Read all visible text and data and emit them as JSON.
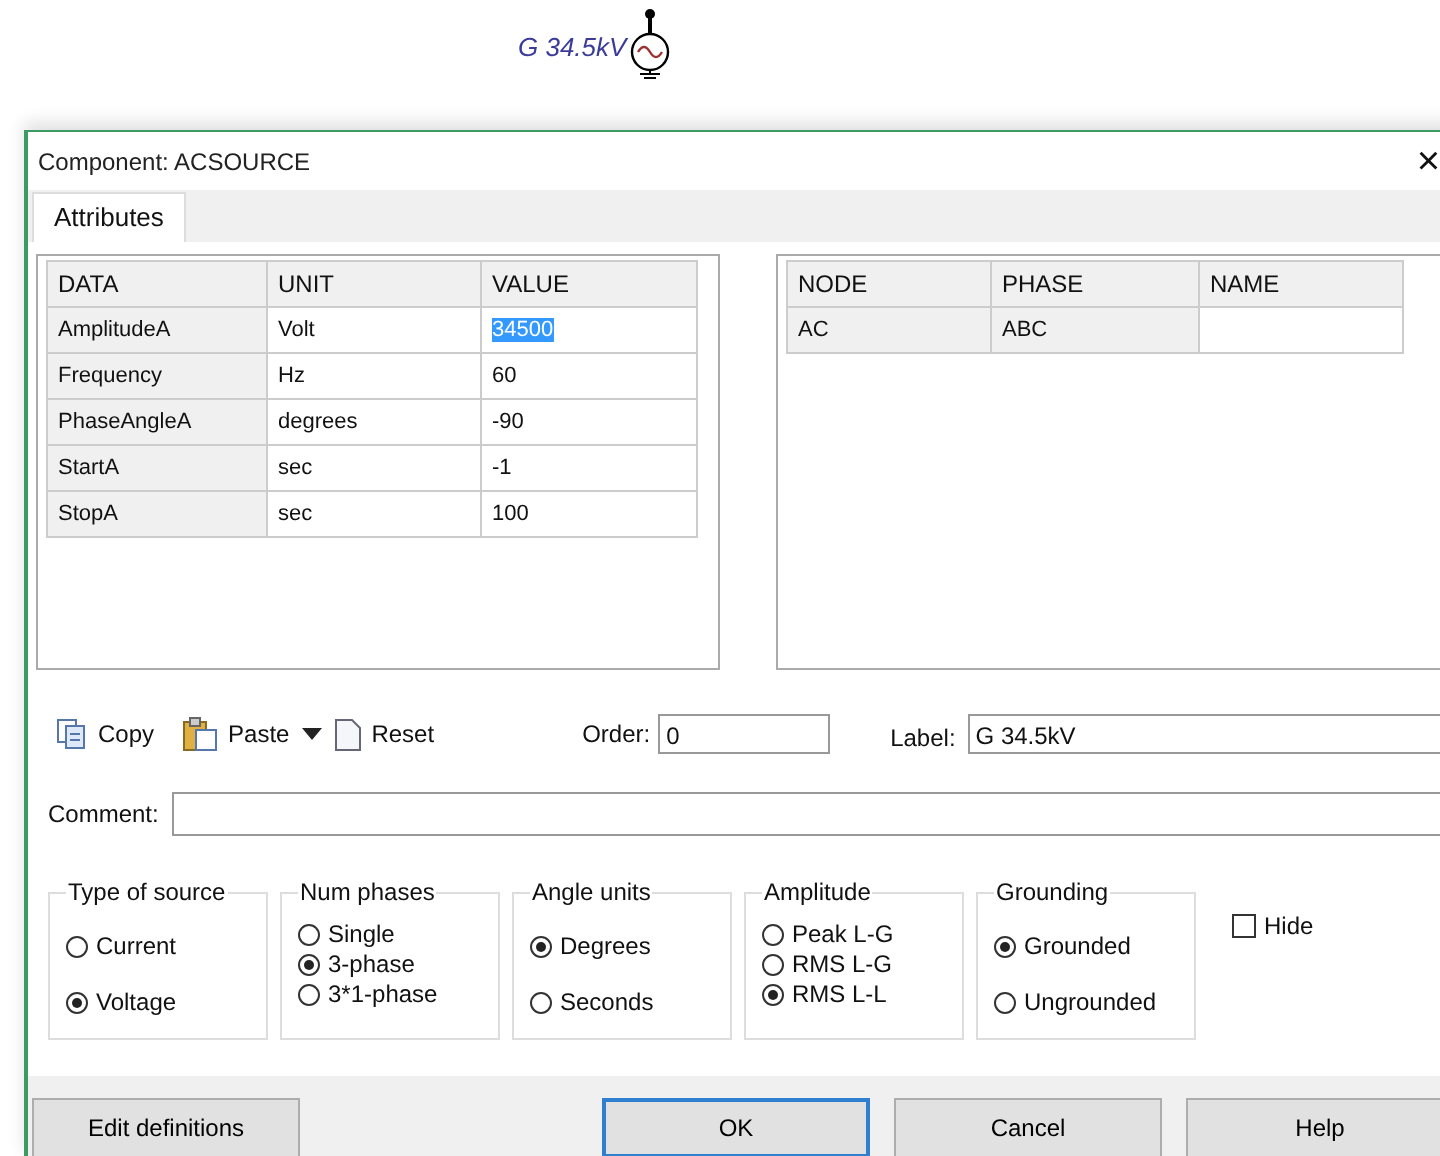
{
  "schematic": {
    "label": "G 34.5kV"
  },
  "window": {
    "title": "Component: ACSOURCE",
    "close": "×"
  },
  "tabs": [
    {
      "label": "Attributes",
      "selected": true
    }
  ],
  "data_table": {
    "columns": [
      "DATA",
      "UNIT",
      "VALUE"
    ],
    "rows": [
      {
        "data": "AmplitudeA",
        "unit": "Volt",
        "value": "34500",
        "selected": true
      },
      {
        "data": "Frequency",
        "unit": "Hz",
        "value": "60",
        "selected": false
      },
      {
        "data": "PhaseAngleA",
        "unit": "degrees",
        "value": "-90",
        "selected": false
      },
      {
        "data": "StartA",
        "unit": "sec",
        "value": "-1",
        "selected": false
      },
      {
        "data": "StopA",
        "unit": "sec",
        "value": "100",
        "selected": false
      }
    ]
  },
  "node_table": {
    "columns": [
      "NODE",
      "PHASE",
      "NAME"
    ],
    "rows": [
      {
        "node": "AC",
        "phase": "ABC"
      }
    ]
  },
  "toolbar": [
    {
      "kind": "copy",
      "label": "Copy"
    },
    {
      "kind": "paste",
      "label": "Paste"
    },
    {
      "kind": "reset",
      "label": "Reset"
    }
  ],
  "order": {
    "label": "Order:",
    "value": "0"
  },
  "label_field": {
    "label": "Label:",
    "value": "G 34.5kV"
  },
  "comment": {
    "label": "Comment:"
  },
  "groups": [
    {
      "title": "Type of source",
      "options": [
        {
          "label": "Current",
          "selected": false
        },
        {
          "label": "Voltage",
          "selected": true
        }
      ]
    },
    {
      "title": "Num phases",
      "options": [
        {
          "label": "Single",
          "selected": false
        },
        {
          "label": "3-phase",
          "selected": true
        },
        {
          "label": "3*1-phase",
          "selected": false
        }
      ]
    },
    {
      "title": "Angle units",
      "options": [
        {
          "label": "Degrees",
          "selected": true
        },
        {
          "label": "Seconds",
          "selected": false
        }
      ]
    },
    {
      "title": "Amplitude",
      "options": [
        {
          "label": "Peak L-G",
          "selected": false
        },
        {
          "label": "RMS L-G",
          "selected": false
        },
        {
          "label": "RMS L-L",
          "selected": true
        }
      ]
    },
    {
      "title": "Grounding",
      "options": [
        {
          "label": "Grounded",
          "selected": true
        },
        {
          "label": "Ungrounded",
          "selected": false
        }
      ]
    }
  ],
  "hide": {
    "label": "Hide",
    "checked": false
  },
  "buttons": [
    {
      "label": "Edit definitions",
      "default": false
    },
    {
      "label": "OK",
      "default": true
    },
    {
      "label": "Cancel",
      "default": false
    },
    {
      "label": "Help",
      "default": false
    }
  ]
}
